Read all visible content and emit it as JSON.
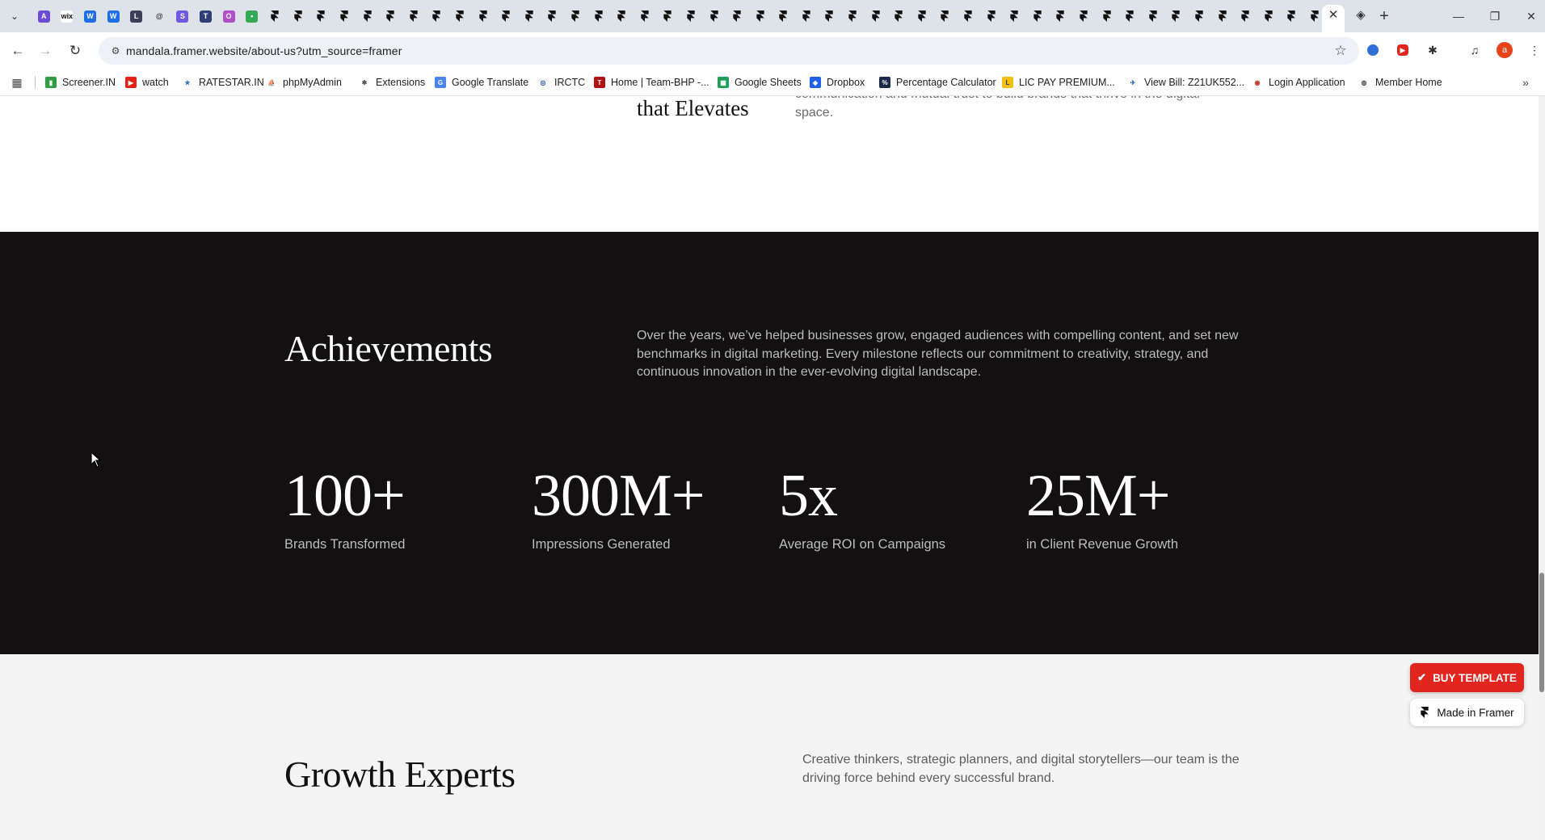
{
  "browser": {
    "tab_icons": [
      {
        "name": "arc-icon",
        "color": "#6b4bd8",
        "glyph": "A"
      },
      {
        "name": "wix-icon",
        "color": "#ffffff",
        "glyph": "wix",
        "text_color": "#111"
      },
      {
        "name": "blue-w-icon",
        "color": "#1e6ee8",
        "glyph": "W"
      },
      {
        "name": "blue-w-icon",
        "color": "#1e6ee8",
        "glyph": "W"
      },
      {
        "name": "lumo-icon",
        "color": "#3b3f5c",
        "glyph": "L"
      },
      {
        "name": "spiral-icon",
        "color": "#dee3ea",
        "glyph": "@",
        "text_color": "#333"
      },
      {
        "name": "purple-s-icon",
        "color": "#7158e2",
        "glyph": "S"
      },
      {
        "name": "layout-icon",
        "color": "#2f3e7a",
        "glyph": "T"
      },
      {
        "name": "circle-icon",
        "color": "#b04fc8",
        "glyph": "O"
      },
      {
        "name": "green-leaf-icon",
        "color": "#35a853",
        "glyph": "•"
      }
    ],
    "framer_tab_count": 47,
    "new_tab_label": "+",
    "url": "mandala.framer.website/about-us?utm_source=framer",
    "bookmarks": [
      {
        "label": "Screener.IN",
        "color": "#2f9e44",
        "glyph": "▮"
      },
      {
        "label": "watch",
        "color": "#e62117",
        "glyph": "▶"
      },
      {
        "label": "RATESTAR.IN",
        "color": "#ffffff",
        "glyph": "★",
        "text_color": "#2a6ab8"
      },
      {
        "label": "phpMyAdmin",
        "color": "#ffffff",
        "glyph": "⛵",
        "text_color": "#e08a1e"
      },
      {
        "label": "Extensions",
        "color": "#ffffff",
        "glyph": "✱",
        "text_color": "#555"
      },
      {
        "label": "Google Translate",
        "color": "#4a84ef",
        "glyph": "G"
      },
      {
        "label": "IRCTC",
        "color": "#ffffff",
        "glyph": "◎",
        "text_color": "#2b4a9a"
      },
      {
        "label": "Home | Team-BHP -...",
        "color": "#b11212",
        "glyph": "T"
      },
      {
        "label": "Google Sheets",
        "color": "#1e9e55",
        "glyph": "▦"
      },
      {
        "label": "Dropbox",
        "color": "#1f62e6",
        "glyph": "◆"
      },
      {
        "label": "Percentage Calculator",
        "color": "#1b2a4a",
        "glyph": "%"
      },
      {
        "label": "LIC PAY PREMIUM...",
        "color": "#f4c010",
        "glyph": "L",
        "text_color": "#1a3a8a"
      },
      {
        "label": "View Bill: Z21UK552...",
        "color": "#ffffff",
        "glyph": "✈",
        "text_color": "#1a5fb4"
      },
      {
        "label": "Login Application",
        "color": "#ffffff",
        "glyph": "◉",
        "text_color": "#c0392b"
      },
      {
        "label": "Member Home",
        "color": "#ffffff",
        "glyph": "◍",
        "text_color": "#555"
      }
    ]
  },
  "page": {
    "top_heading": "that Elevates",
    "top_text": "communication and mutual trust to build brands that thrive in the digital space.",
    "achievements": {
      "title": "Achievements",
      "text": "Over the years, we’ve helped businesses grow, engaged audiences with compelling content, and set new benchmarks in digital marketing. Every milestone reflects our commitment to creativity, strategy, and continuous innovation in the ever-evolving digital landscape.",
      "stats": [
        {
          "value": "100+",
          "label": "Brands Transformed"
        },
        {
          "value": "300M+",
          "label": "Impressions Generated"
        },
        {
          "value": "5x",
          "label": "Average ROI on Campaigns"
        },
        {
          "value": "25M+",
          "label": "in Client Revenue Growth"
        }
      ]
    },
    "growth": {
      "title": "Growth Experts",
      "text": "Creative thinkers, strategic planners, and digital storytellers—our team is the driving force behind every successful brand."
    },
    "buy_template_label": "BUY TEMPLATE",
    "made_in_framer_label": "Made in Framer"
  },
  "colors": {
    "dark_section": "#121011",
    "light_section": "#f4f4f4",
    "buy_button": "#e0261f"
  }
}
